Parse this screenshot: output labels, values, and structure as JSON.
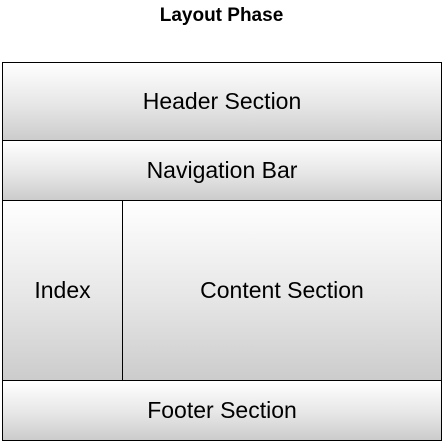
{
  "title": "Layout Phase",
  "sections": {
    "header": "Header Section",
    "navigation": "Navigation Bar",
    "index": "Index",
    "content": "Content Section",
    "footer": "Footer Section"
  },
  "colors": {
    "border": "#000000",
    "fill_top": "#ffffff",
    "fill_bottom": "#cccccc",
    "text": "#000000"
  }
}
